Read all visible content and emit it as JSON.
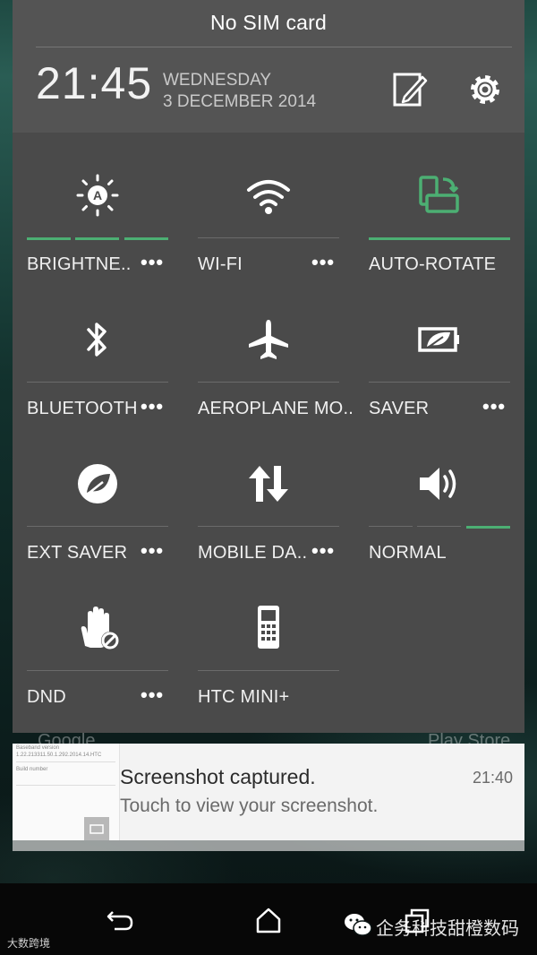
{
  "status": {
    "sim": "No SIM card"
  },
  "header": {
    "time": "21:45",
    "day": "WEDNESDAY",
    "date": "3 DECEMBER 2014"
  },
  "tiles": [
    {
      "label": "BRIGHTNE..",
      "icon": "brightness-auto-icon",
      "more": "•••",
      "active": true
    },
    {
      "label": "WI-FI",
      "icon": "wifi-icon",
      "more": "•••",
      "active": false
    },
    {
      "label": "AUTO-ROTATE",
      "icon": "auto-rotate-icon",
      "more": "",
      "active": true
    },
    {
      "label": "BLUETOOTH",
      "icon": "bluetooth-icon",
      "more": "•••",
      "active": false
    },
    {
      "label": "AEROPLANE MO..",
      "icon": "airplane-icon",
      "more": "",
      "active": false
    },
    {
      "label": "SAVER",
      "icon": "battery-saver-icon",
      "more": "•••",
      "active": false
    },
    {
      "label": "EXT SAVER",
      "icon": "extreme-saver-icon",
      "more": "•••",
      "active": false
    },
    {
      "label": "MOBILE DA..",
      "icon": "mobile-data-icon",
      "more": "•••",
      "active": false
    },
    {
      "label": "NORMAL",
      "icon": "volume-icon",
      "more": "",
      "active": true
    },
    {
      "label": "DND",
      "icon": "do-not-disturb-icon",
      "more": "•••",
      "active": false
    },
    {
      "label": "HTC MINI+",
      "icon": "htc-mini-icon",
      "more": "",
      "active": false
    }
  ],
  "notification": {
    "title": "Screenshot captured.",
    "body": "Touch to view your screenshot.",
    "time": "21:40",
    "thumb_lines": [
      "Baseband version",
      "1.22.213311.50.1.292.2014.14.HTC",
      "Build number"
    ]
  },
  "behind": {
    "left": "Google",
    "right": "Play Store"
  },
  "watermark": {
    "text": "企务科技甜橙数码",
    "corner": "大数跨境"
  },
  "colors": {
    "accent": "#4caf73",
    "panel": "#4a4a4a",
    "header": "#545454"
  }
}
